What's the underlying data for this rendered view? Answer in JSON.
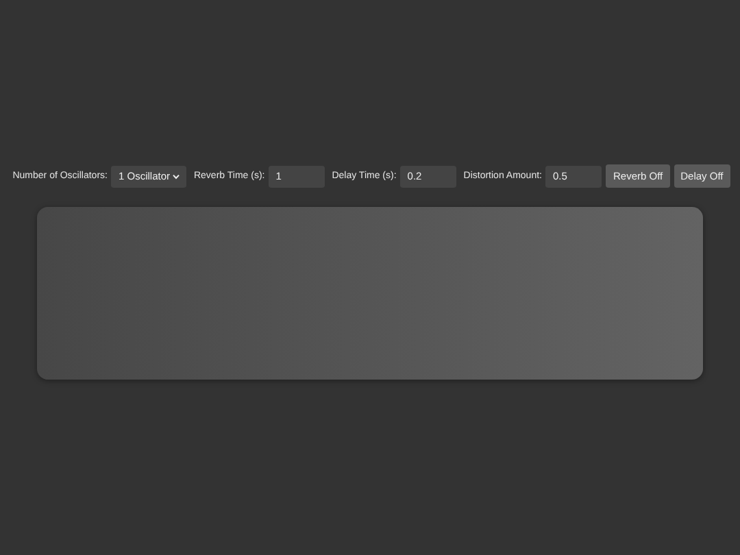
{
  "controls": [
    {
      "kind": "select",
      "label": "Number of Oscillators:",
      "value": "1 Oscillator"
    },
    {
      "kind": "input",
      "label": "Reverb Time (s):",
      "value": "1"
    },
    {
      "kind": "input",
      "label": "Delay Time (s):",
      "value": "0.2"
    },
    {
      "kind": "input",
      "label": "Distortion Amount:",
      "value": "0.5"
    },
    {
      "kind": "button",
      "label": "Reverb Off"
    },
    {
      "kind": "button",
      "label": "Delay Off"
    }
  ]
}
